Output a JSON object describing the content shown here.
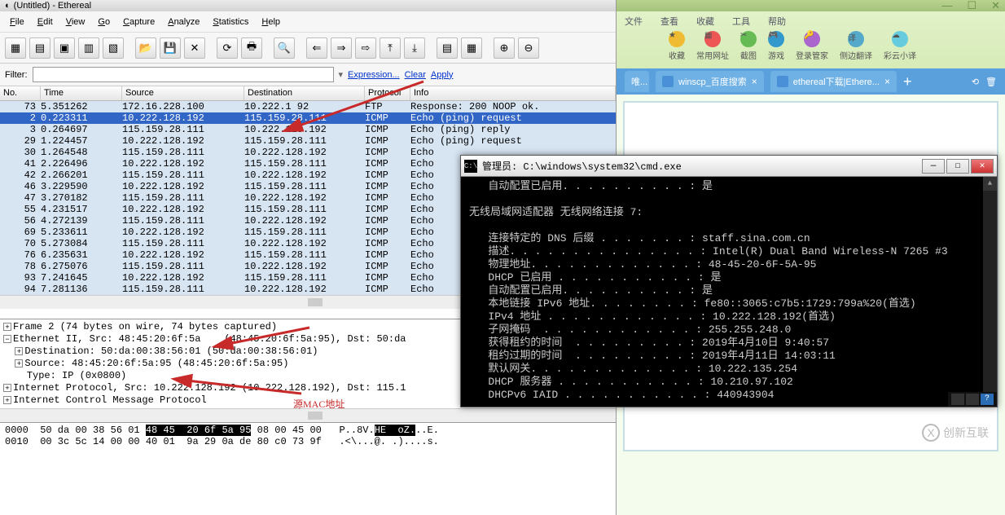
{
  "ethereal": {
    "title": "(Untitled) - Ethereal",
    "menu": {
      "file": "File",
      "edit": "Edit",
      "view": "View",
      "go": "Go",
      "capture": "Capture",
      "analyze": "Analyze",
      "statistics": "Statistics",
      "help": "Help"
    },
    "filter": {
      "label": "Filter:",
      "value": "",
      "expression": "Expression...",
      "clear": "Clear",
      "apply": "Apply"
    },
    "columns": {
      "no": "No.",
      "time": "Time",
      "source": "Source",
      "destination": "Destination",
      "protocol": "Protocol",
      "info": "Info"
    },
    "rows": [
      {
        "no": "73",
        "time": "5.351262",
        "src": "172.16.228.100",
        "dst": "10.222.1      92",
        "proto": "FTP",
        "info": "Response: 200 NOOP ok.",
        "sel": false
      },
      {
        "no": "2",
        "time": "0.223311",
        "src": "10.222.128.192",
        "dst": "115.159.28.111",
        "proto": "ICMP",
        "info": "Echo (ping) request",
        "sel": true
      },
      {
        "no": "3",
        "time": "0.264697",
        "src": "115.159.28.111",
        "dst": "10.222.128.192",
        "proto": "ICMP",
        "info": "Echo (ping) reply",
        "sel": false
      },
      {
        "no": "29",
        "time": "1.224457",
        "src": "10.222.128.192",
        "dst": "115.159.28.111",
        "proto": "ICMP",
        "info": "Echo (ping) request",
        "sel": false
      },
      {
        "no": "30",
        "time": "1.264548",
        "src": "115.159.28.111",
        "dst": "10.222.128.192",
        "proto": "ICMP",
        "info": "Echo",
        "sel": false
      },
      {
        "no": "41",
        "time": "2.226496",
        "src": "10.222.128.192",
        "dst": "115.159.28.111",
        "proto": "ICMP",
        "info": "Echo",
        "sel": false
      },
      {
        "no": "42",
        "time": "2.266201",
        "src": "115.159.28.111",
        "dst": "10.222.128.192",
        "proto": "ICMP",
        "info": "Echo",
        "sel": false
      },
      {
        "no": "46",
        "time": "3.229590",
        "src": "10.222.128.192",
        "dst": "115.159.28.111",
        "proto": "ICMP",
        "info": "Echo",
        "sel": false
      },
      {
        "no": "47",
        "time": "3.270182",
        "src": "115.159.28.111",
        "dst": "10.222.128.192",
        "proto": "ICMP",
        "info": "Echo",
        "sel": false
      },
      {
        "no": "55",
        "time": "4.231517",
        "src": "10.222.128.192",
        "dst": "115.159.28.111",
        "proto": "ICMP",
        "info": "Echo",
        "sel": false
      },
      {
        "no": "56",
        "time": "4.272139",
        "src": "115.159.28.111",
        "dst": "10.222.128.192",
        "proto": "ICMP",
        "info": "Echo",
        "sel": false
      },
      {
        "no": "69",
        "time": "5.233611",
        "src": "10.222.128.192",
        "dst": "115.159.28.111",
        "proto": "ICMP",
        "info": "Echo",
        "sel": false
      },
      {
        "no": "70",
        "time": "5.273084",
        "src": "115.159.28.111",
        "dst": "10.222.128.192",
        "proto": "ICMP",
        "info": "Echo",
        "sel": false
      },
      {
        "no": "76",
        "time": "6.235631",
        "src": "10.222.128.192",
        "dst": "115.159.28.111",
        "proto": "ICMP",
        "info": "Echo",
        "sel": false
      },
      {
        "no": "78",
        "time": "6.275076",
        "src": "115.159.28.111",
        "dst": "10.222.128.192",
        "proto": "ICMP",
        "info": "Echo",
        "sel": false
      },
      {
        "no": "93",
        "time": "7.241645",
        "src": "10.222.128.192",
        "dst": "115.159.28.111",
        "proto": "ICMP",
        "info": "Echo",
        "sel": false
      },
      {
        "no": "94",
        "time": "7.281136",
        "src": "115.159.28.111",
        "dst": "10.222.128.192",
        "proto": "ICMP",
        "info": "Echo",
        "sel": false
      }
    ],
    "details": {
      "l1": "Frame 2 (74 bytes on wire, 74 bytes captured)",
      "l2": "Ethernet II, Src: 48:45:20:6f:5a    (48:45:20:6f:5a:95), Dst: 50:da",
      "l3": "Destination: 50:da:00:38:56:01 (50:da:00:38:56:01)",
      "l4": "Source: 48:45:20:6f:5a:95 (48:45:20:6f:5a:95)",
      "l5": "Type: IP (0x0800)",
      "l6": "Internet Protocol, Src: 10.222.128.192 (10.222.128.192), Dst: 115.1",
      "l7": "Internet Control Message Protocol",
      "annot": "源MAC地址"
    },
    "hex": {
      "l1a": "0000  50 da 00 38 56 01 ",
      "l1b": "48 45  20 6f 5a 95",
      "l1c": " 08 00 45 00   P..8V.",
      "l1d": "HE  oZ.",
      "l1e": "..E.",
      "l2": "0010  00 3c 5c 14 00 00 40 01  9a 29 0a de 80 c0 73 9f   .<\\...@. .)....s."
    }
  },
  "browser": {
    "topmenu": {
      "file": "文件",
      "view": "查看",
      "fav": "收藏",
      "tools": "工具",
      "help": "帮助"
    },
    "icons": {
      "i1": "收藏",
      "i2": "常用网址",
      "i3": "截图",
      "i4": "游戏",
      "i5": "登录管家",
      "i6": "侧边翻译",
      "i7": "彩云小译"
    },
    "tabs": [
      {
        "label": "唯..."
      },
      {
        "label": "winscp_百度搜索"
      },
      {
        "label": "ethereal下载|Ethere..."
      }
    ],
    "watermark": "创新互联"
  },
  "cmd": {
    "title": "管理员: C:\\windows\\system32\\cmd.exe",
    "body": "   自动配置已启用. . . . . . . . . . : 是\n\n无线局域网适配器 无线网络连接 7:\n\n   连接特定的 DNS 后缀 . . . . . . . : staff.sina.com.cn\n   描述. . . . . . . . . . . . . . . : Intel(R) Dual Band Wireless-N 7265 #3\n   物理地址. . . . . . . . . . . . . : 48-45-20-6F-5A-95\n   DHCP 已启用 . . . . . . . . . . . : 是\n   自动配置已启用. . . . . . . . . . : 是\n   本地链接 IPv6 地址. . . . . . . . : fe80::3065:c7b5:1729:799a%20(首选)\n   IPv4 地址 . . . . . . . . . . . . : 10.222.128.192(首选)\n   子网掩码  . . . . . . . . . . . . : 255.255.248.0\n   获得租约的时间  . . . . . . . . . : 2019年4月10日 9:40:57\n   租约过期的时间  . . . . . . . . . : 2019年4月11日 14:03:11\n   默认网关. . . . . . . . . . . . . : 10.222.135.254\n   DHCP 服务器 . . . . . . . . . . . : 10.210.97.102\n   DHCPv6 IAID . . . . . . . . . . . : 440943904"
  }
}
